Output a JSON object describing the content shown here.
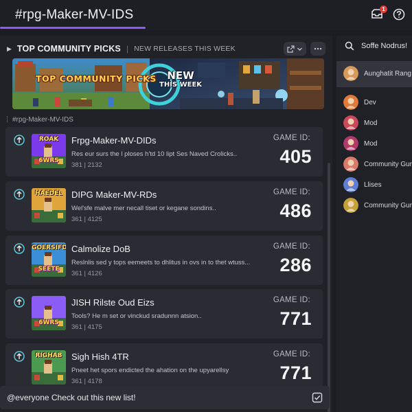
{
  "channel": {
    "title": "#rpg-Maker-MV-IDS",
    "notif_count": "1"
  },
  "section": {
    "title": "TOP COMMUNITY PICKS",
    "separator": "|",
    "subtitle": "NEW RELEASES THIS WEEK"
  },
  "banner": {
    "left_text": "TOP COMMUNITY PICKS",
    "right_text_1": "NEW",
    "right_text_2": "THIS WEEK"
  },
  "channel_label": "#rpg-Maker-MV-IDS",
  "game_id_label": "GAME ID:",
  "cards": [
    {
      "title": "Frpg-Maker-MV-DIDs",
      "desc": "Res eur surs the l ploses h'td 10 lipt Ses Naved Crolicks..",
      "meta": "381 | 2132",
      "game_id": "405",
      "thumb_text_1": "ROAK",
      "thumb_text_2": "6WRS",
      "accent": "#7c3aed"
    },
    {
      "title": "DIPG Maker-MV-RDs",
      "desc": "Wel'sfe malve mer necall tiset or kegane sondins..",
      "meta": "361 | 4125",
      "game_id": "486",
      "thumb_text_1": "HAEDEL",
      "thumb_text_2": "",
      "accent": "#e0a53a"
    },
    {
      "title": "Calmolize DoB",
      "desc": "Reslnlis sed y tops eemeets to dhlitus in ovs in to thet wtuss...",
      "meta": "361 | 4126",
      "game_id": "286",
      "thumb_text_1": "GOERSIFD",
      "thumb_text_2": "SEETE",
      "accent": "#3a8fd6"
    },
    {
      "title": "JISH Rilste Oud Eizs",
      "desc": "Tools? He m set or vinckud sradunnn atsion..",
      "meta": "361 | 4175",
      "game_id": "771",
      "thumb_text_1": "",
      "thumb_text_2": "6WRS",
      "accent": "#8b5cf6"
    },
    {
      "title": "Sigh Hish 4TR",
      "desc": "Pneet het spors endicted the ahation on the upyarellsy",
      "meta": "361 | 4178",
      "game_id": "771",
      "thumb_text_1": "RIGHAB",
      "thumb_text_2": "",
      "accent": "#4a9a52"
    }
  ],
  "composer": {
    "text": "@everyone Check out this new list!"
  },
  "sidebar": {
    "search_label": "Soffe Nodrus!",
    "members": [
      {
        "name": "Aunghatit Rang",
        "color": "#d59a5a",
        "active": true
      },
      {
        "name": "Dev",
        "color": "#e07a3a"
      },
      {
        "name": "Mod",
        "color": "#c9485b"
      },
      {
        "name": "Mod",
        "color": "#b03a6a"
      },
      {
        "name": "Community Guru",
        "color": "#d97a6a"
      },
      {
        "name": "Llises",
        "color": "#5f7fd6"
      },
      {
        "name": "Community Guru",
        "color": "#c4a23a"
      }
    ]
  }
}
